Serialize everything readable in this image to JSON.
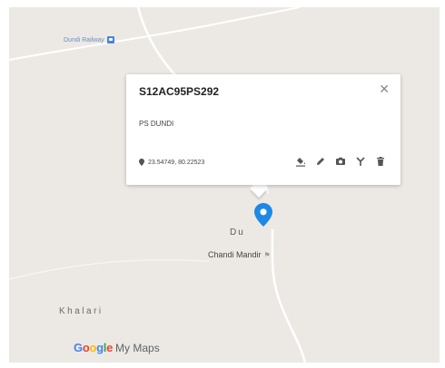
{
  "map": {
    "places": {
      "railway": "Dundi Railway",
      "dundi": "Du",
      "chandi_mandir": "Chandi Mandir",
      "khalari": "Khalari"
    },
    "logo": {
      "word": "Google",
      "suffix": "My Maps"
    },
    "colors": {
      "background": "#ece9e4",
      "road": "#ffffff",
      "marker": "#1e88e5",
      "railway_badge": "#4a86d8"
    }
  },
  "popup": {
    "title": "S12AC95PS292",
    "description": "PS DUNDI",
    "coordinates": "23.54749, 80.22523",
    "tools": [
      "paint-bucket-icon",
      "pencil-icon",
      "camera-icon",
      "directions-icon",
      "trash-icon"
    ]
  }
}
